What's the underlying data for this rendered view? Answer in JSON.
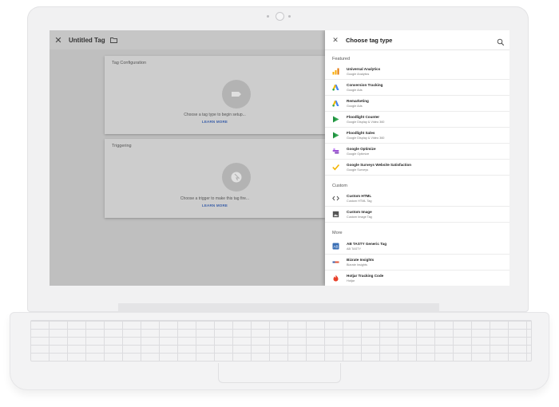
{
  "header": {
    "title": "Untitled Tag"
  },
  "tag_config": {
    "title": "Tag Configuration",
    "description": "Choose a tag type to begin setup...",
    "link": "LEARN MORE"
  },
  "triggering": {
    "title": "Triggering",
    "description": "Choose a trigger to make this tag fire...",
    "link": "LEARN MORE"
  },
  "panel": {
    "title": "Choose tag type",
    "sections": {
      "featured": "Featured",
      "custom": "Custom",
      "more": "More"
    },
    "featured": [
      {
        "name": "Universal Analytics",
        "sub": "Google Analytics",
        "icon": "analytics-icon",
        "color": "#f9ab00"
      },
      {
        "name": "Conversion Tracking",
        "sub": "Google Ads",
        "icon": "google-ads-icon",
        "color": "#4285f4"
      },
      {
        "name": "Remarketing",
        "sub": "Google Ads",
        "icon": "google-ads-icon",
        "color": "#4285f4"
      },
      {
        "name": "Floodlight Counter",
        "sub": "Google Display & Video 360",
        "icon": "floodlight-icon",
        "color": "#34a853"
      },
      {
        "name": "Floodlight Sales",
        "sub": "Google Display & Video 360",
        "icon": "floodlight-icon",
        "color": "#34a853"
      },
      {
        "name": "Google Optimize",
        "sub": "Google Optimize",
        "icon": "optimize-icon",
        "color": "#9c4fd6"
      },
      {
        "name": "Google Surveys Website Satisfaction",
        "sub": "Google Surveys",
        "icon": "surveys-icon",
        "color": "#f4b400"
      }
    ],
    "custom": [
      {
        "name": "Custom HTML",
        "sub": "Custom HTML Tag",
        "icon": "code-icon",
        "color": "#555555"
      },
      {
        "name": "Custom Image",
        "sub": "Custom Image Tag",
        "icon": "image-icon",
        "color": "#555555"
      }
    ],
    "more": [
      {
        "name": "AB TASTY Generic Tag",
        "sub": "AB TASTY",
        "icon": "abtasty-icon",
        "color": "#3a6fb5"
      },
      {
        "name": "Bizrate Insights",
        "sub": "Bizrate Insights",
        "icon": "bizrate-icon",
        "color": "#e0573a"
      },
      {
        "name": "Hotjar Tracking Code",
        "sub": "Hotjar",
        "icon": "hotjar-icon",
        "color": "#e8402a"
      }
    ]
  }
}
